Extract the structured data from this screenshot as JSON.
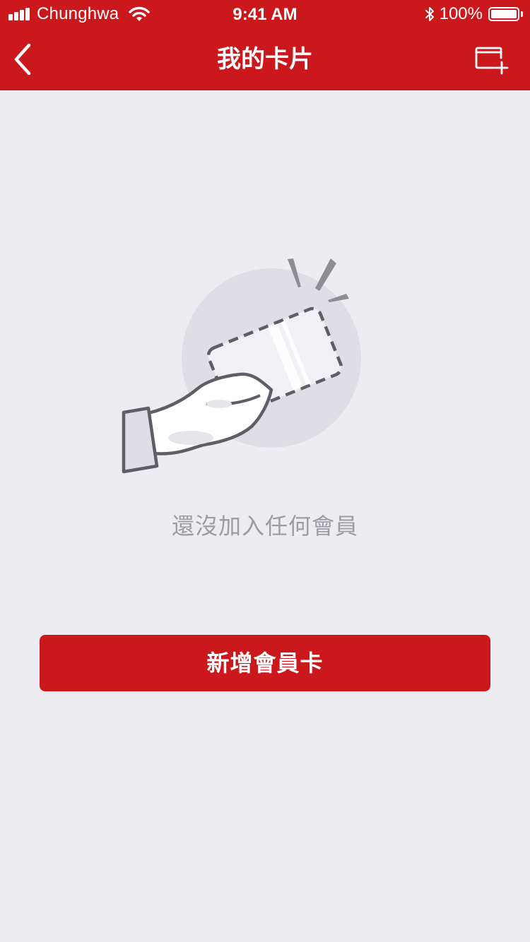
{
  "status_bar": {
    "carrier": "Chunghwa",
    "time": "9:41 AM",
    "battery_percent": "100%",
    "signal_icon": "signal-bars-icon",
    "wifi_icon": "wifi-icon",
    "bluetooth_icon": "bluetooth-icon",
    "battery_icon": "battery-icon",
    "battery_level": 1.0
  },
  "nav": {
    "title": "我的卡片",
    "back_icon": "chevron-left-icon",
    "add_card_icon": "add-card-icon"
  },
  "empty_state": {
    "illustration": "hand-holding-card-illustration",
    "message": "還沒加入任何會員"
  },
  "actions": {
    "add_member_card_label": "新增會員卡"
  },
  "colors": {
    "brand_red": "#CA181D",
    "background": "#EDECF1",
    "muted_text": "#9C9CA3",
    "illustration_stroke": "#5F5E66",
    "illustration_circle": "#DFDEE5"
  }
}
